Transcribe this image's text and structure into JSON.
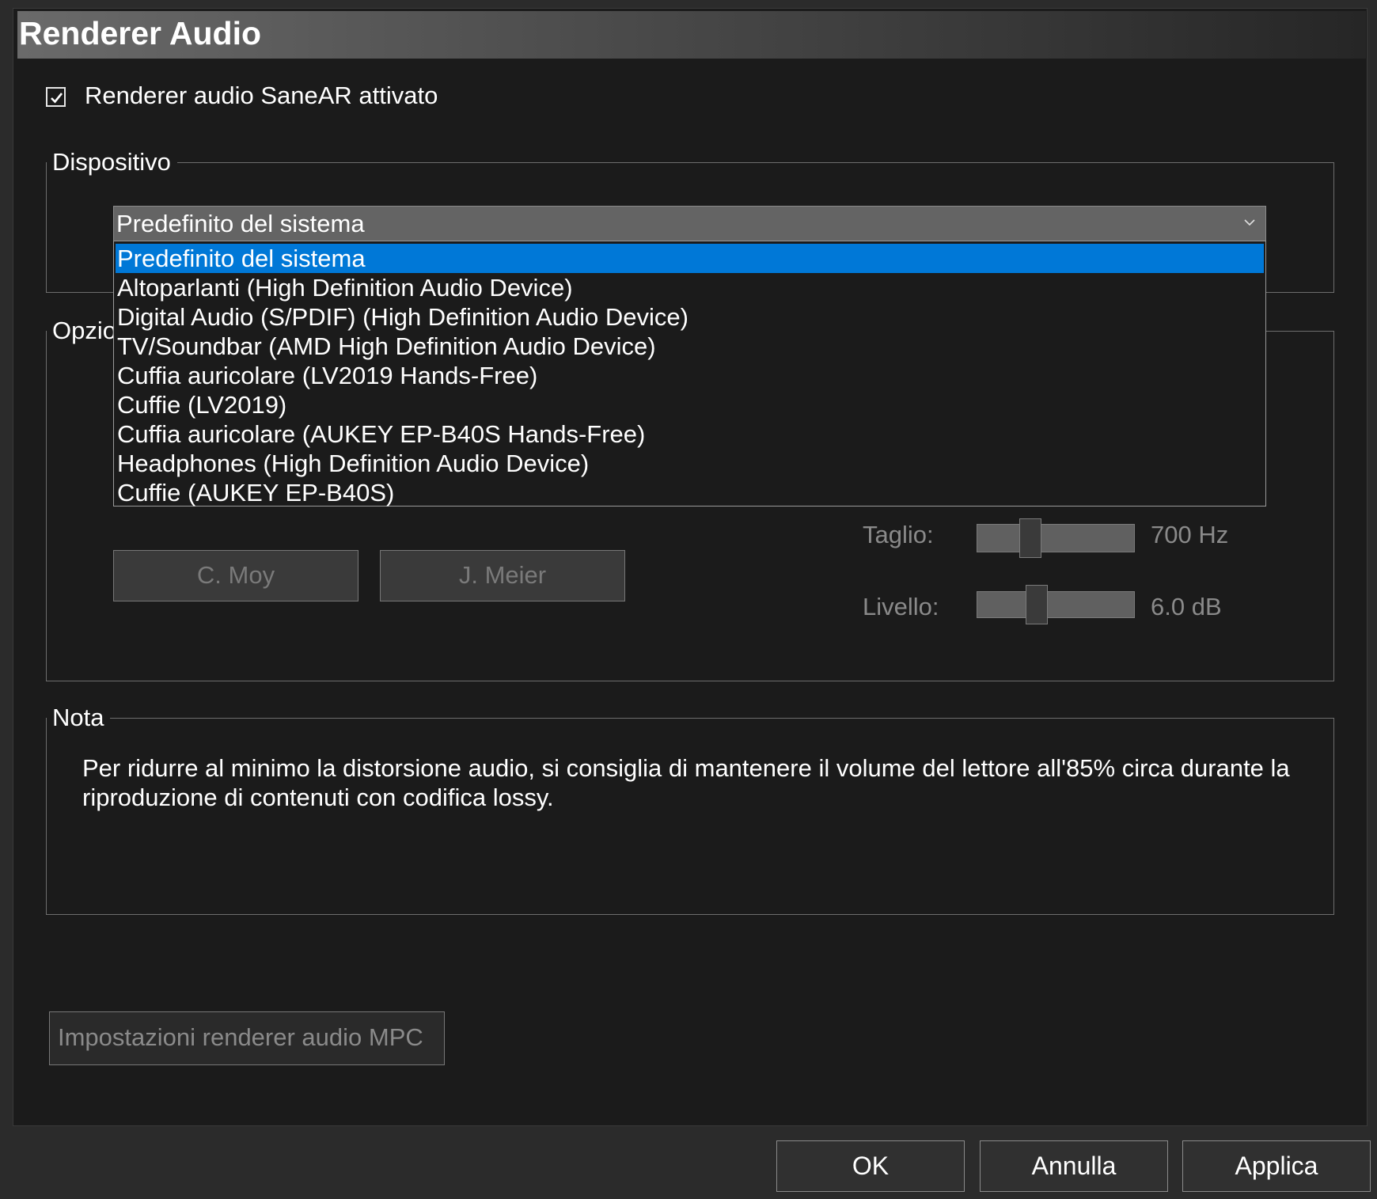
{
  "header": {
    "title": "Renderer Audio"
  },
  "enable_checkbox": {
    "label": "Renderer audio SaneAR attivato",
    "checked": true
  },
  "device_group": {
    "title": "Dispositivo",
    "selected": "Predefinito del sistema",
    "options": [
      "Predefinito del sistema",
      "Altoparlanti (High Definition Audio Device)",
      "Digital Audio (S/PDIF) (High Definition Audio Device)",
      "TV/Soundbar (AMD High Definition Audio Device)",
      "Cuffia auricolare (LV2019 Hands-Free)",
      "Cuffie (LV2019)",
      "Cuffia auricolare (AUKEY EP-B40S Hands-Free)",
      "Headphones (High Definition Audio Device)",
      "Cuffie (AUKEY EP-B40S)"
    ]
  },
  "options_group": {
    "title_visible": "Opzio",
    "preset_buttons": [
      "C. Moy",
      "J. Meier"
    ],
    "cutoff": {
      "label": "Taglio:",
      "value_text": "700 Hz",
      "position": 0.27
    },
    "level": {
      "label": "Livello:",
      "value_text": "6.0 dB",
      "position": 0.38
    }
  },
  "note_group": {
    "title": "Nota",
    "text": "Per ridurre al minimo la distorsione audio, si consiglia di mantenere il volume del lettore all'85% circa durante la riproduzione di contenuti con codifica lossy."
  },
  "mpc_settings_button": "Impostazioni renderer audio MPC",
  "footer": {
    "ok": "OK",
    "cancel": "Annulla",
    "apply": "Applica"
  }
}
